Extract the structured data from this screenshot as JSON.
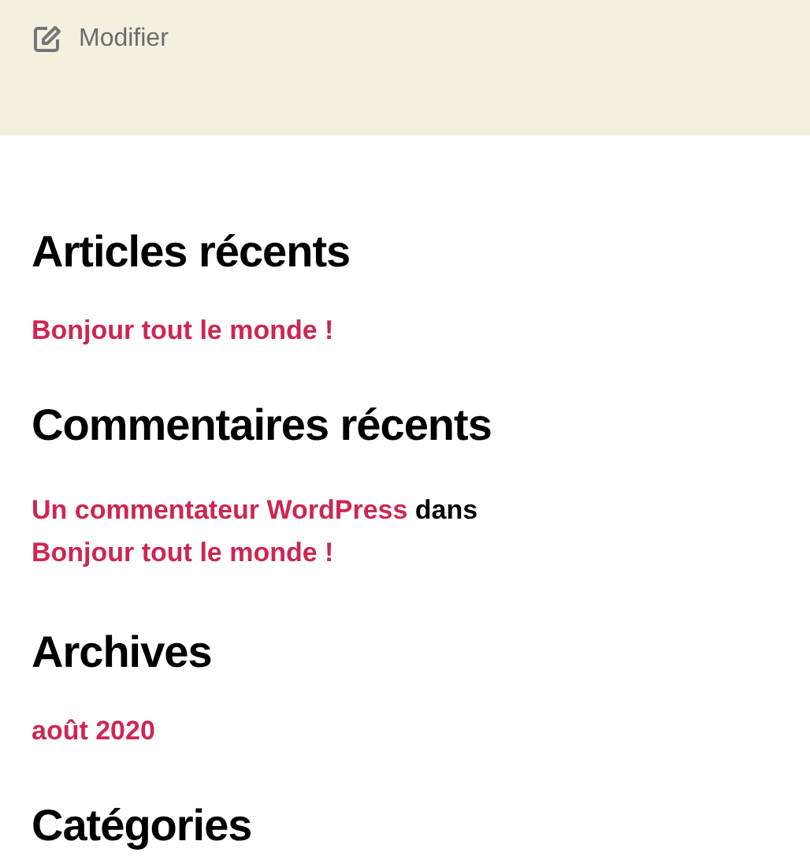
{
  "edit_link": {
    "label": "Modifier"
  },
  "widgets": [
    {
      "title": "Articles récents",
      "kind": "links",
      "items": [
        "Bonjour tout le monde !"
      ]
    },
    {
      "title": "Commentaires récents",
      "kind": "comments",
      "comments": [
        {
          "author": "Un commentateur WordPress",
          "connector": "dans",
          "post": "Bonjour tout le monde !"
        }
      ]
    },
    {
      "title": "Archives",
      "kind": "links",
      "items": [
        "août 2020"
      ]
    },
    {
      "title": "Catégories",
      "kind": "links"
    }
  ]
}
